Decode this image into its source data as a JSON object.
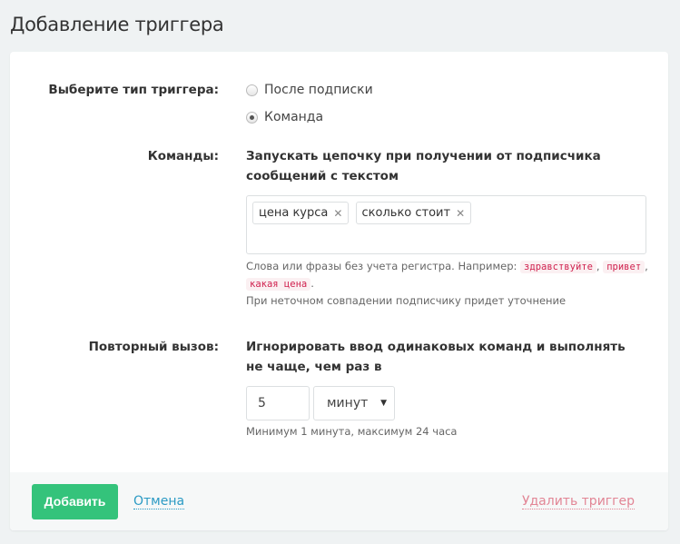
{
  "title": "Добавление триггера",
  "trigger_type": {
    "label": "Выберите тип триггера:",
    "options": [
      {
        "label": "После подписки",
        "selected": false
      },
      {
        "label": "Команда",
        "selected": true
      }
    ]
  },
  "commands": {
    "label": "Команды:",
    "description": "Запускать цепочку при получении от подписчика сообщений с текстом",
    "tags": [
      "цена курса",
      "сколько стоит"
    ],
    "hint_prefix": "Слова или фразы без учета регистра. Например:",
    "examples": [
      "здравствуйте",
      "привет",
      "какая цена"
    ],
    "comma": ",",
    "period": ".",
    "hint_note": "При неточном совпадении подписчику придет уточнение"
  },
  "repeat": {
    "label": "Повторный вызов:",
    "description": "Игнорировать ввод одинаковых команд и выполнять не чаще, чем раз в",
    "value": "5",
    "unit": "минут",
    "arrow": "▼",
    "hint": "Минимум 1 минута, максимум 24 часа"
  },
  "footer": {
    "add": "Добавить",
    "cancel": "Отмена",
    "delete": "Удалить триггер"
  }
}
